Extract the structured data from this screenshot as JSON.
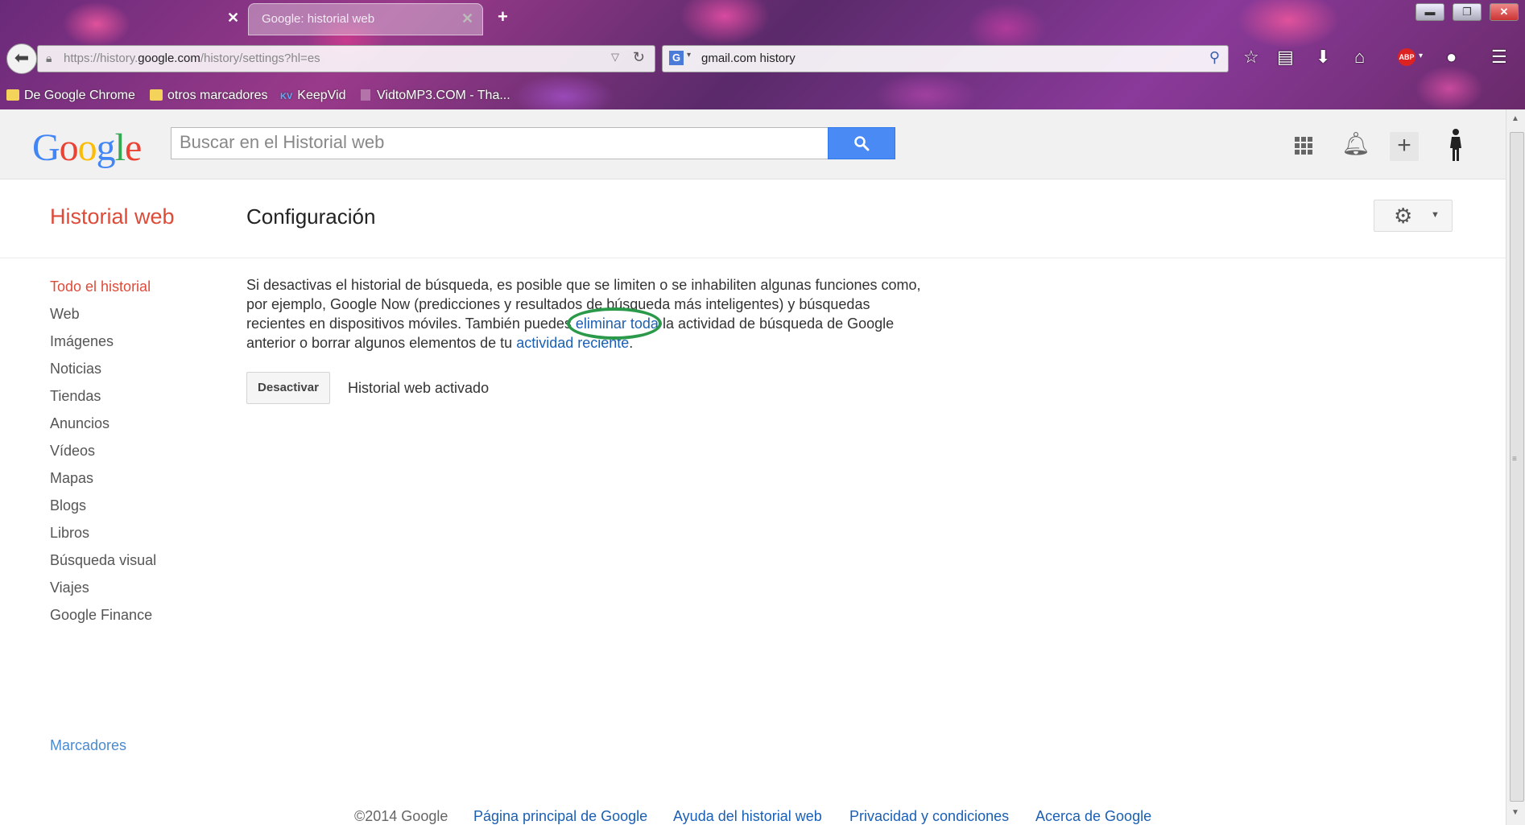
{
  "browser": {
    "tabs": [
      {
        "title": "",
        "active": false
      },
      {
        "title": "Google: historial web",
        "active": true
      }
    ],
    "new_tab": "+",
    "window_controls": {
      "minimize": "▬",
      "maximize": "❐",
      "close": "✕"
    },
    "url": {
      "prefix": "https://history.",
      "domain": "google.com",
      "path": "/history/settings?hl=es"
    },
    "search_box": {
      "engine_icon": "G",
      "query": "gmail.com history"
    },
    "toolbar_icons": [
      "star-icon",
      "reading-list-icon",
      "download-icon",
      "home-icon",
      "adblock-icon",
      "extension-icon",
      "menu-icon"
    ],
    "adblock_label": "ABP",
    "bookmarks": [
      {
        "label": "De Google Chrome",
        "icon": "folder-icon"
      },
      {
        "label": "otros marcadores",
        "icon": "folder-icon"
      },
      {
        "label": "KeepVid",
        "icon": "keepvid-icon",
        "badge": "KV"
      },
      {
        "label": "VidtoMP3.COM - Tha...",
        "icon": "page-icon"
      }
    ]
  },
  "header": {
    "logo_letters": [
      {
        "char": "G",
        "color": "#4285f4"
      },
      {
        "char": "o",
        "color": "#ea4335"
      },
      {
        "char": "o",
        "color": "#fbbc05"
      },
      {
        "char": "g",
        "color": "#4285f4"
      },
      {
        "char": "l",
        "color": "#34a853"
      },
      {
        "char": "e",
        "color": "#ea4335"
      }
    ],
    "search_placeholder": "Buscar en el Historial web",
    "search_button_icon": "magnifier-icon",
    "plus_label": "+"
  },
  "subheader": {
    "section_title": "Historial web",
    "page_title": "Configuración"
  },
  "sidebar": {
    "items": [
      {
        "label": "Todo el historial",
        "active": true
      },
      {
        "label": "Web"
      },
      {
        "label": "Imágenes"
      },
      {
        "label": "Noticias"
      },
      {
        "label": "Tiendas"
      },
      {
        "label": "Anuncios"
      },
      {
        "label": "Vídeos"
      },
      {
        "label": "Mapas"
      },
      {
        "label": "Blogs"
      },
      {
        "label": "Libros"
      },
      {
        "label": "Búsqueda visual"
      },
      {
        "label": "Viajes"
      },
      {
        "label": "Google Finance"
      }
    ],
    "bookmarks_link": "Marcadores"
  },
  "content": {
    "desc_part1": "Si desactivas el historial de búsqueda, es posible que se limiten o se inhabiliten algunas funciones como, por ejemplo, Google Now (predicciones y resultados de búsqueda más inteligentes) y búsquedas recientes en dispositivos móviles. También puedes ",
    "link_delete_all": "eliminar toda",
    "desc_part2": " la actividad de búsqueda de Google anterior o borrar algunos elementos de tu ",
    "link_recent_activity": "actividad reciente",
    "desc_part3": ".",
    "deactivate_button": "Desactivar",
    "status": "Historial web activado"
  },
  "footer": {
    "copyright": "©2014 Google",
    "links": [
      "Página principal de Google",
      "Ayuda del historial web",
      "Privacidad y condiciones",
      "Acerca de Google"
    ]
  },
  "colors": {
    "accent_red": "#dd4b39",
    "link_blue": "#1a5fb4",
    "search_button": "#4a8af4",
    "annotation_green": "#2a9a4a"
  }
}
